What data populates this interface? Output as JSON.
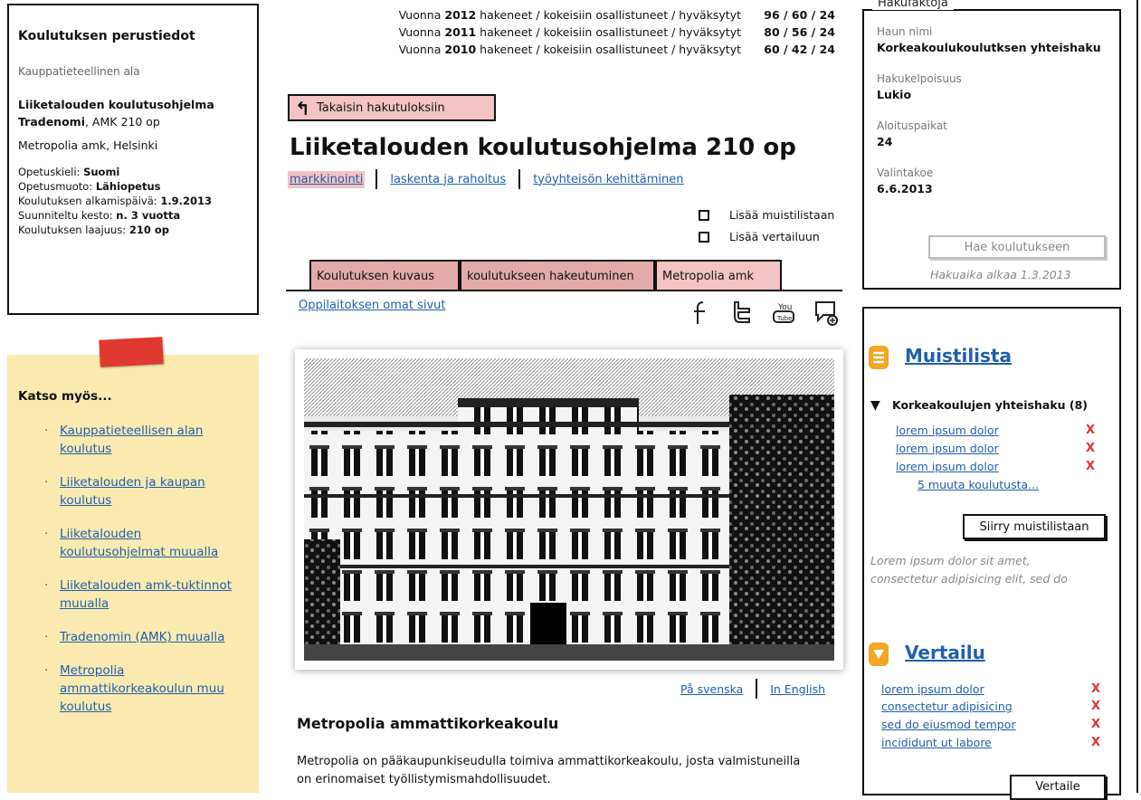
{
  "basic_info": {
    "title": "Koulutuksen perustiedot",
    "field": "Kauppatieteellinen ala",
    "program": "Liiketalouden koulutusohjelma",
    "degree_bold": "Tradenomi",
    "degree_rest": ", AMK 210 op",
    "location": "Metropolia amk, Helsinki",
    "rows": [
      {
        "label": "Opetuskieli: ",
        "value": "Suomi"
      },
      {
        "label": "Opetusmuoto: ",
        "value": "Lähiopetus"
      },
      {
        "label": "Koulutuksen alkamispäivä: ",
        "value": "1.9.2013"
      },
      {
        "label": "Suunniteltu kesto: ",
        "value": "n. 3 vuotta"
      },
      {
        "label": "Koulutuksen laajuus: ",
        "value": "210 op"
      }
    ]
  },
  "see_also": {
    "title": "Katso myös...",
    "items": [
      "Kauppatieteellisen alan koulutus",
      "Liiketalouden ja kaupan koulutus",
      "Liiketalouden koulutusohjelmat muualla",
      "Liiketalouden amk-tuktinnot muualla",
      "Tradenomin (AMK)  muualla",
      "Metropolia ammattikorkeakoulun muu koulutus"
    ]
  },
  "stats": [
    {
      "prefix": "Vuonna ",
      "year": "2012",
      "suffix": " hakeneet / kokeisiin osallistuneet / hyväksytyt",
      "nums": "96 / 60 / 24"
    },
    {
      "prefix": "Vuonna ",
      "year": "2011",
      "suffix": " hakeneet / kokeisiin osallistuneet / hyväksytyt",
      "nums": "80 / 56 / 24"
    },
    {
      "prefix": "Vuonna ",
      "year": "2010",
      "suffix": " hakeneet / kokeisiin osallistuneet / hyväksytyt",
      "nums": "60 / 42 / 24"
    }
  ],
  "back_label": "Takaisin hakutuloksiin",
  "page_title": "Liiketalouden koulutusohjelma 210 op",
  "tags": [
    "markkinointi",
    "laskenta ja rahoitus",
    "työyhteisön kehittäminen"
  ],
  "checks": {
    "memo": "Lisää muistilistaan",
    "compare": "Lisää vertailuun"
  },
  "tabs": [
    "Koulutuksen kuvaus",
    "koulutukseen hakeutuminen",
    "Metropolia amk"
  ],
  "school_link": "Oppilaitoksen omat sivut",
  "social_icons": [
    "facebook-icon",
    "twitter-icon",
    "youtube-icon",
    "chat-icon"
  ],
  "lang_links": [
    "På svenska",
    "In English"
  ],
  "school_title": "Metropolia ammattikorkeakoulu",
  "school_desc": "Metropolia on pääkaupunkiseudulla toimiva ammattikorkeakoulu, josta valmistuneilla on erinomaiset työllistymismahdollisuudet.",
  "facts": {
    "legend": "Hakufaktoja",
    "items": [
      {
        "label": "Haun nimi",
        "value": "Korkeakoulukoulutksen yhteishaku"
      },
      {
        "label": "Hakukelpoisuus",
        "value": "Lukio"
      },
      {
        "label": "Aloituspaikat",
        "value": "24"
      },
      {
        "label": "Valintakoe",
        "value": "6.6.2013"
      }
    ],
    "apply_label": "Hae koulutukseen",
    "apply_note": "Hakuaika alkaa 1.3.2013"
  },
  "memo": {
    "title": "Muistilista",
    "group": "Korkeakoulujen yhteishaku (8)",
    "links": [
      "lorem ipsum dolor",
      "lorem ipsum dolor",
      "lorem ipsum dolor"
    ],
    "more": "5 muuta koulutusta...",
    "goto_label": "Siirry muistilistaan",
    "text": "Lorem ipsum dolor sit amet, consectetur adipisicing elit, sed do",
    "remove_mark": "X"
  },
  "compare": {
    "title": "Vertailu",
    "links": [
      "lorem ipsum dolor",
      "consectetur adipisicing",
      "sed do eiusmod tempor",
      "incididunt ut labore"
    ],
    "button": "Vertaile"
  },
  "colors": {
    "link": "#1f5fae",
    "tab": "#e2aaa9",
    "tab_active": "#f4c3c3",
    "note": "#fbeab0",
    "accent": "#f3a623",
    "remove": "#d33333"
  }
}
